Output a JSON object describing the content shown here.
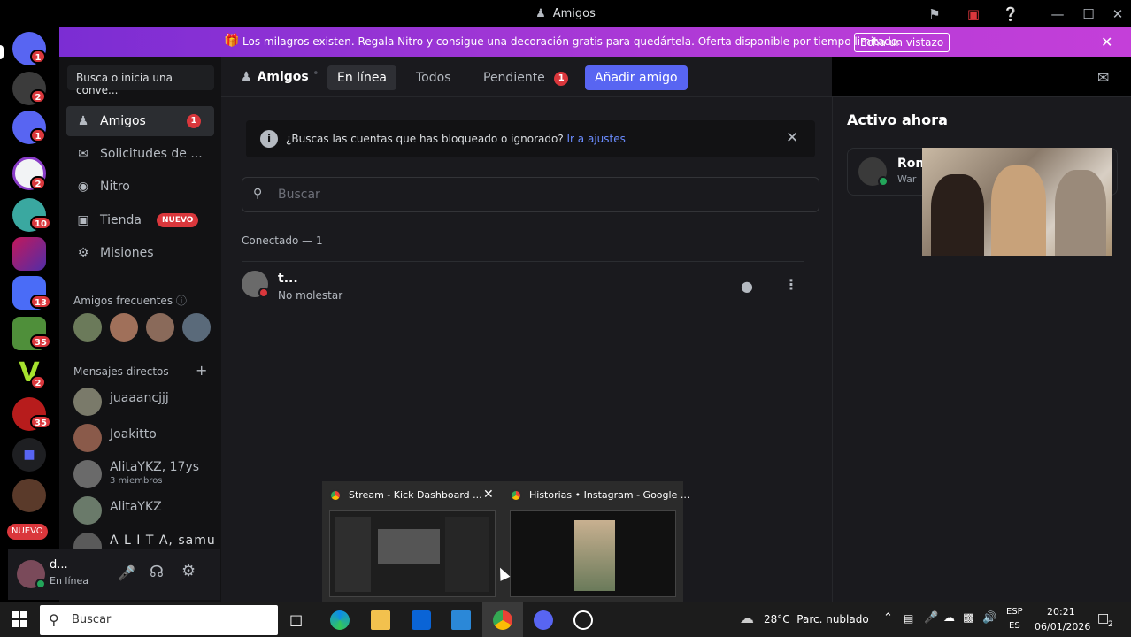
{
  "window": {
    "title": "Amigos"
  },
  "server_rail": {
    "badges": [
      "1",
      "2",
      "1",
      "2",
      "10",
      "13",
      "35",
      "2",
      "35"
    ],
    "new_label": "NUEVO"
  },
  "banner": {
    "message": "Los milagros existen. Regala Nitro y consigue una decoración gratis para quedártela. Oferta disponible por tiempo limitado.",
    "cta": "Echa un vistazo"
  },
  "sidebar": {
    "search_placeholder": "Busca o inicia una conve...",
    "nav": [
      {
        "label": "Amigos",
        "badge": "1"
      },
      {
        "label": "Solicitudes de ..."
      },
      {
        "label": "Nitro"
      },
      {
        "label": "Tienda",
        "badge": "NUEVO"
      },
      {
        "label": "Misiones"
      }
    ],
    "frequent_title": "Amigos frecuentes",
    "dm_title": "Mensajes directos",
    "dms": [
      {
        "name": "juaaancjjj"
      },
      {
        "name": "Joakitto"
      },
      {
        "name": "AlitaYKZ, 17ys",
        "sub": "3 miembros"
      },
      {
        "name": "AlitaYKZ"
      },
      {
        "name": "A L I T A, samu"
      }
    ]
  },
  "user": {
    "name": "d...",
    "status": "En línea"
  },
  "topbar": {
    "title": "Amigos",
    "tabs": [
      {
        "label": "En línea"
      },
      {
        "label": "Todos"
      },
      {
        "label": "Pendiente",
        "badge": "1"
      },
      {
        "label": "Añadir amigo"
      }
    ]
  },
  "notice": {
    "text": "¿Buscas las cuentas que has bloqueado o ignorado?",
    "link": "Ir a ajustes"
  },
  "search": {
    "placeholder": "Buscar"
  },
  "online": {
    "header": "Conectado — 1",
    "friends": [
      {
        "name": "t...",
        "status": "No molestar"
      }
    ]
  },
  "active_now": {
    "title": "Activo ahora",
    "card_name": "Ron",
    "card_sub": "War"
  },
  "previews": [
    {
      "title": "Stream - Kick Dashboard ..."
    },
    {
      "title": "Historias • Instagram - Google ..."
    }
  ],
  "taskbar": {
    "search_placeholder": "Buscar",
    "weather": "28°C  Parc. nublado",
    "lang_top": "ESP",
    "lang_bottom": "ES",
    "time": "20:21",
    "date": "06/01/2026",
    "notif_count": "2"
  },
  "colors": {
    "blurple": "#5865f2",
    "red": "#da373c",
    "green": "#23a55a",
    "banner": "#b03ad6"
  }
}
